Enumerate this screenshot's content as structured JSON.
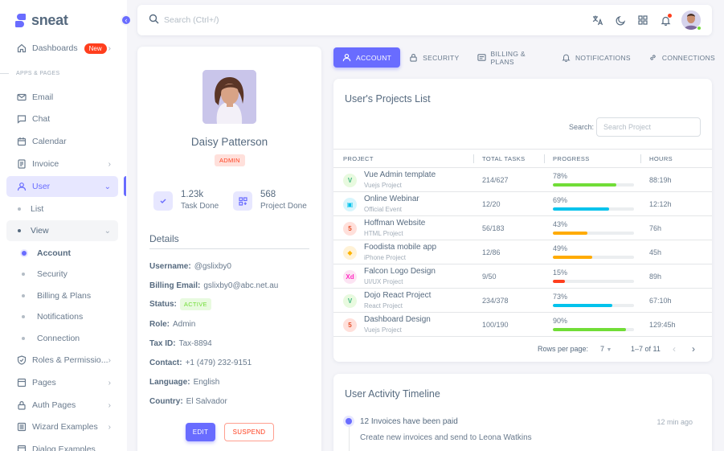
{
  "brand": {
    "name": "sneat",
    "accent": "#696cff"
  },
  "sidebar": {
    "dashboards": {
      "label": "Dashboards",
      "badge": "New"
    },
    "section": "APPS & PAGES",
    "items": [
      {
        "label": "Email",
        "icon": "mail-icon"
      },
      {
        "label": "Chat",
        "icon": "chat-icon"
      },
      {
        "label": "Calendar",
        "icon": "calendar-icon"
      },
      {
        "label": "Invoice",
        "icon": "invoice-icon"
      },
      {
        "label": "User",
        "icon": "user-icon"
      }
    ],
    "user_sub": {
      "list": "List",
      "view": "View"
    },
    "view_sub": [
      "Account",
      "Security",
      "Billing & Plans",
      "Notifications",
      "Connection"
    ],
    "bottom": [
      {
        "label": "Roles & Permissio...",
        "icon": "shield-check-icon"
      },
      {
        "label": "Pages",
        "icon": "pages-icon"
      },
      {
        "label": "Auth Pages",
        "icon": "lock-icon"
      },
      {
        "label": "Wizard Examples",
        "icon": "wizard-icon"
      },
      {
        "label": "Dialog Examples",
        "icon": "dialog-icon"
      }
    ]
  },
  "search": {
    "placeholder": "Search (Ctrl+/)"
  },
  "profile": {
    "name": "Daisy Patterson",
    "role": "ADMIN",
    "stats": [
      {
        "value": "1.23k",
        "label": "Task Done",
        "icon": "check-icon"
      },
      {
        "value": "568",
        "label": "Project Done",
        "icon": "grid-icon"
      }
    ],
    "details_title": "Details",
    "details": {
      "username_label": "Username:",
      "username": "@gslixby0",
      "email_label": "Billing Email:",
      "email": "gslixby0@abc.net.au",
      "status_label": "Status:",
      "status": "ACTIVE",
      "role_label": "Role:",
      "role": "Admin",
      "tax_label": "Tax ID:",
      "tax": "Tax-8894",
      "contact_label": "Contact:",
      "contact": "+1 (479) 232-9151",
      "language_label": "Language:",
      "language": "English",
      "country_label": "Country:",
      "country": "El Salvador"
    },
    "edit": "EDIT",
    "suspend": "SUSPEND"
  },
  "tabs": [
    {
      "label": "ACCOUNT",
      "icon": "user-icon"
    },
    {
      "label": "SECURITY",
      "icon": "lock-icon"
    },
    {
      "label": "BILLING & PLANS",
      "icon": "billing-icon"
    },
    {
      "label": "NOTIFICATIONS",
      "icon": "bell-icon"
    },
    {
      "label": "CONNECTIONS",
      "icon": "link-icon"
    }
  ],
  "projects": {
    "title": "User's Projects List",
    "search_label": "Search:",
    "search_placeholder": "Search Project",
    "columns": [
      "PROJECT",
      "TOTAL TASKS",
      "PROGRESS",
      "HOURS"
    ],
    "rows": [
      {
        "name": "Vue Admin template",
        "sub": "Vuejs Project",
        "tasks": "214/627",
        "progress": 78,
        "pct": "78%",
        "color": "#71dd37",
        "hours": "88:19h",
        "icon": "vue-icon",
        "glyph": "V",
        "ic_bg": "#e8fadf",
        "ic_fg": "#41b883"
      },
      {
        "name": "Online Webinar",
        "sub": "Official Event",
        "tasks": "12/20",
        "progress": 69,
        "pct": "69%",
        "color": "#03c3ec",
        "hours": "12:12h",
        "icon": "event-icon",
        "glyph": "▣",
        "ic_bg": "#d7f5fc",
        "ic_fg": "#03c3ec"
      },
      {
        "name": "Hoffman Website",
        "sub": "HTML Project",
        "tasks": "56/183",
        "progress": 43,
        "pct": "43%",
        "color": "#ffab00",
        "hours": "76h",
        "icon": "html5-icon",
        "glyph": "5",
        "ic_bg": "#ffe0db",
        "ic_fg": "#e44d26"
      },
      {
        "name": "Foodista mobile app",
        "sub": "iPhone Project",
        "tasks": "12/86",
        "progress": 49,
        "pct": "49%",
        "color": "#ffab00",
        "hours": "45h",
        "icon": "sketch-icon",
        "glyph": "◆",
        "ic_bg": "#fff2d6",
        "ic_fg": "#fdb300"
      },
      {
        "name": "Falcon Logo Design",
        "sub": "UI/UX Project",
        "tasks": "9/50",
        "progress": 15,
        "pct": "15%",
        "color": "#ff3e1d",
        "hours": "89h",
        "icon": "xd-icon",
        "glyph": "Xd",
        "ic_bg": "#fce4f3",
        "ic_fg": "#ff2bc2"
      },
      {
        "name": "Dojo React Project",
        "sub": "React Project",
        "tasks": "234/378",
        "progress": 73,
        "pct": "73%",
        "color": "#03c3ec",
        "hours": "67:10h",
        "icon": "vue-icon",
        "glyph": "V",
        "ic_bg": "#e8fadf",
        "ic_fg": "#41b883"
      },
      {
        "name": "Dashboard Design",
        "sub": "Vuejs Project",
        "tasks": "100/190",
        "progress": 90,
        "pct": "90%",
        "color": "#71dd37",
        "hours": "129:45h",
        "icon": "html5-icon",
        "glyph": "5",
        "ic_bg": "#ffe0db",
        "ic_fg": "#e44d26"
      }
    ],
    "rows_per_page_label": "Rows per page:",
    "rows_per_page": "7",
    "range": "1–7 of 11"
  },
  "timeline": {
    "title": "User Activity Timeline",
    "event_title": "12 Invoices have been paid",
    "event_time": "12 min ago",
    "event_desc": "Create new invoices and send to Leona Watkins"
  }
}
